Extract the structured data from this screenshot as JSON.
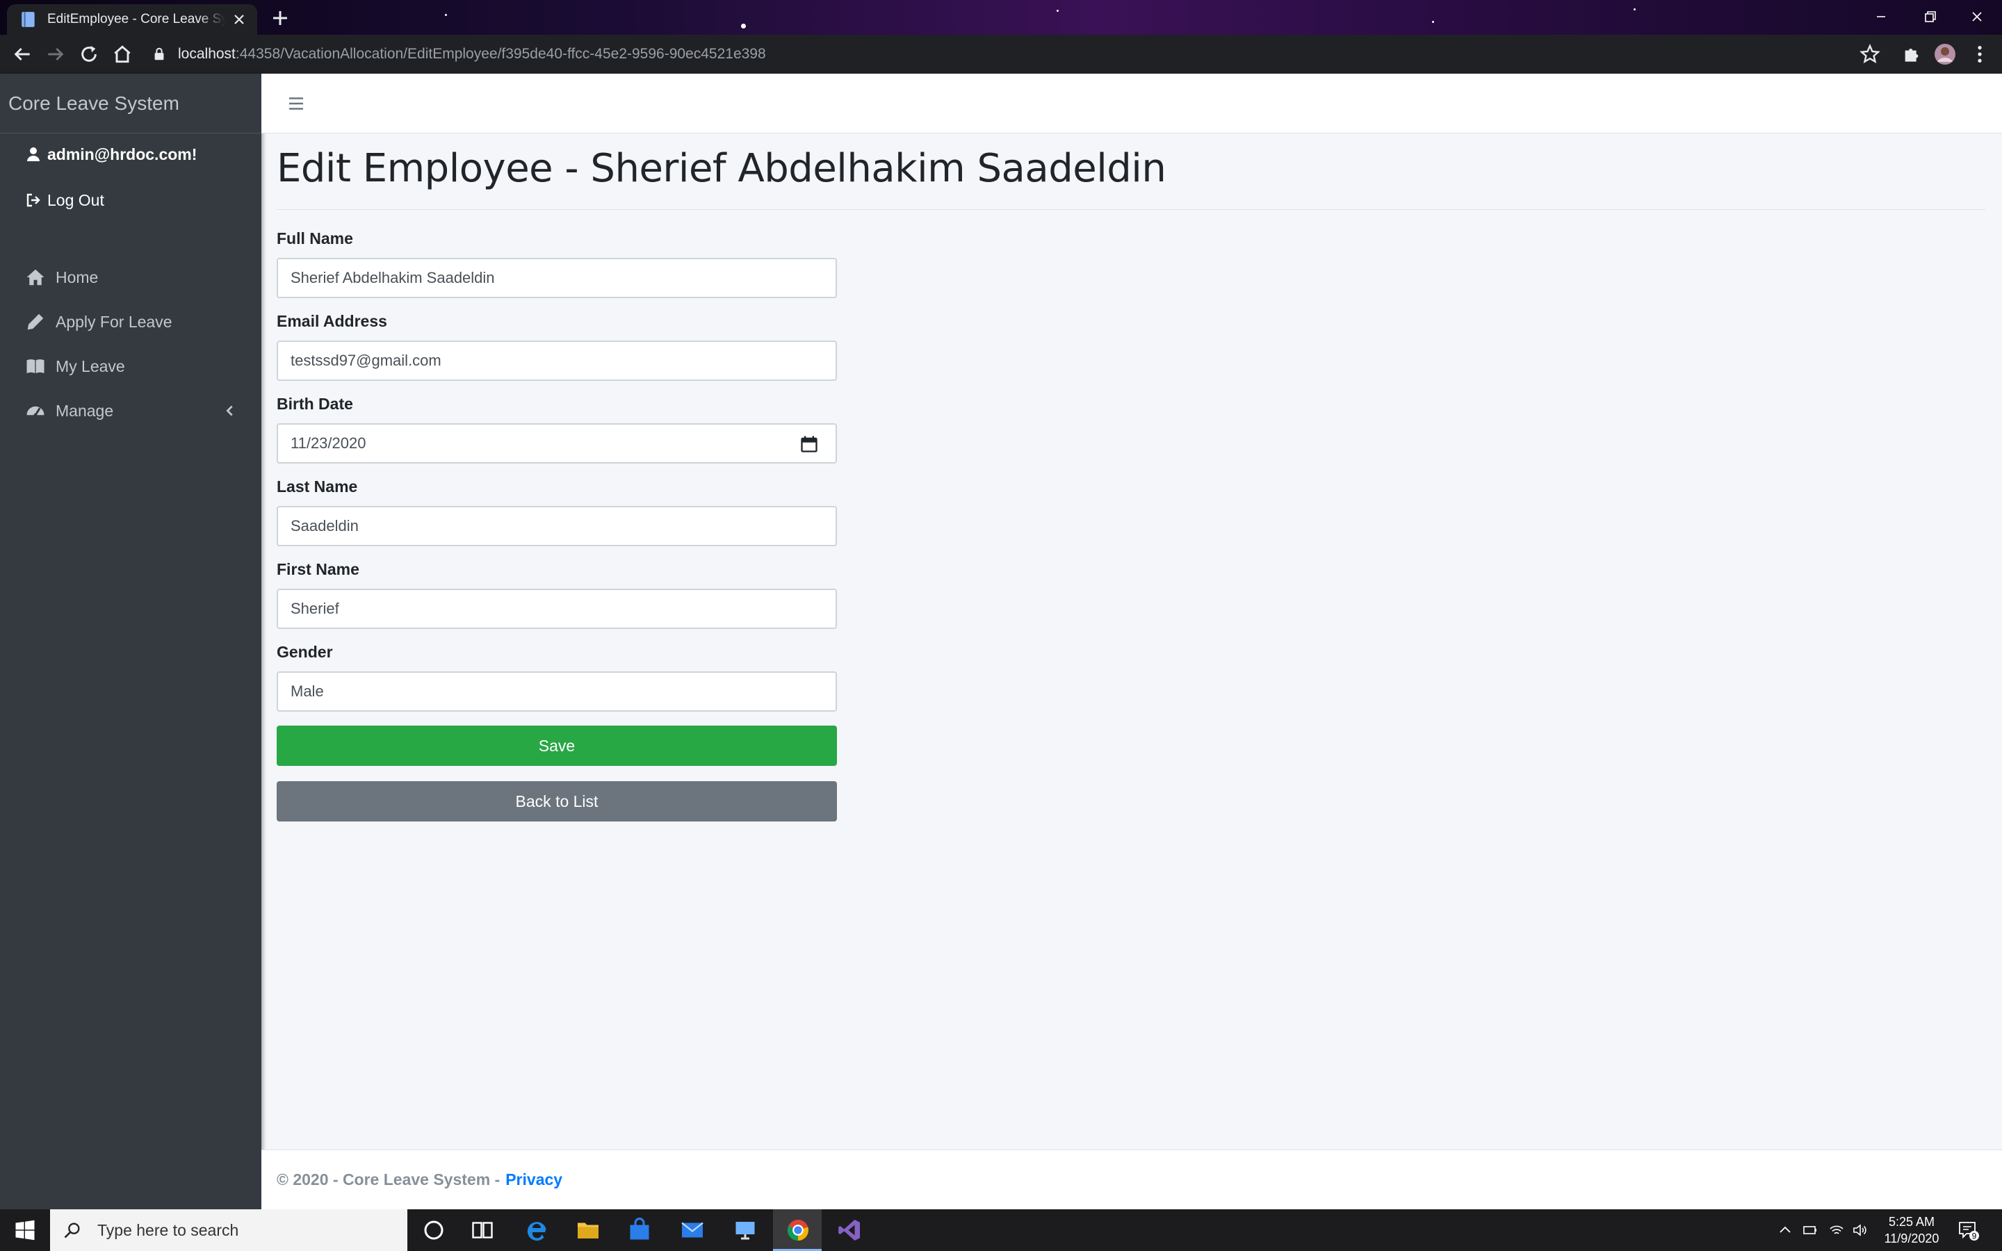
{
  "browser": {
    "tab_title": "EditEmployee - Core Leave System",
    "url_host": "localhost",
    "url_path": ":44358/VacationAllocation/EditEmployee/f395de40-ffcc-45e2-9596-90ec4521e398"
  },
  "sidebar": {
    "brand": "Core Leave System",
    "user": "admin@hrdoc.com!",
    "logout": "Log Out",
    "items": [
      {
        "label": "Home",
        "icon": "home-icon"
      },
      {
        "label": "Apply For Leave",
        "icon": "pencil-icon"
      },
      {
        "label": "My Leave",
        "icon": "book-icon"
      },
      {
        "label": "Manage",
        "icon": "dashboard-icon"
      }
    ]
  },
  "page": {
    "title": "Edit Employee - Sherief Abdelhakim Saadeldin"
  },
  "form": {
    "full_name_label": "Full Name",
    "full_name_value": "Sherief Abdelhakim Saadeldin",
    "email_label": "Email Address",
    "email_value": "testssd97@gmail.com",
    "birth_label": "Birth Date",
    "birth_value": "11/23/2020",
    "last_name_label": "Last Name",
    "last_name_value": "Saadeldin",
    "first_name_label": "First Name",
    "first_name_value": "Sherief",
    "gender_label": "Gender",
    "gender_value": "Male",
    "save_label": "Save",
    "back_label": "Back to List"
  },
  "footer": {
    "text": "© 2020 - Core Leave System -",
    "privacy": "Privacy"
  },
  "taskbar": {
    "search_placeholder": "Type here to search",
    "time": "5:25 AM",
    "date": "11/9/2020",
    "notification_count": "9"
  },
  "colors": {
    "sidebar_bg": "#343a40",
    "save_button": "#28a745",
    "back_button": "#6c757d",
    "link": "#007bff"
  }
}
